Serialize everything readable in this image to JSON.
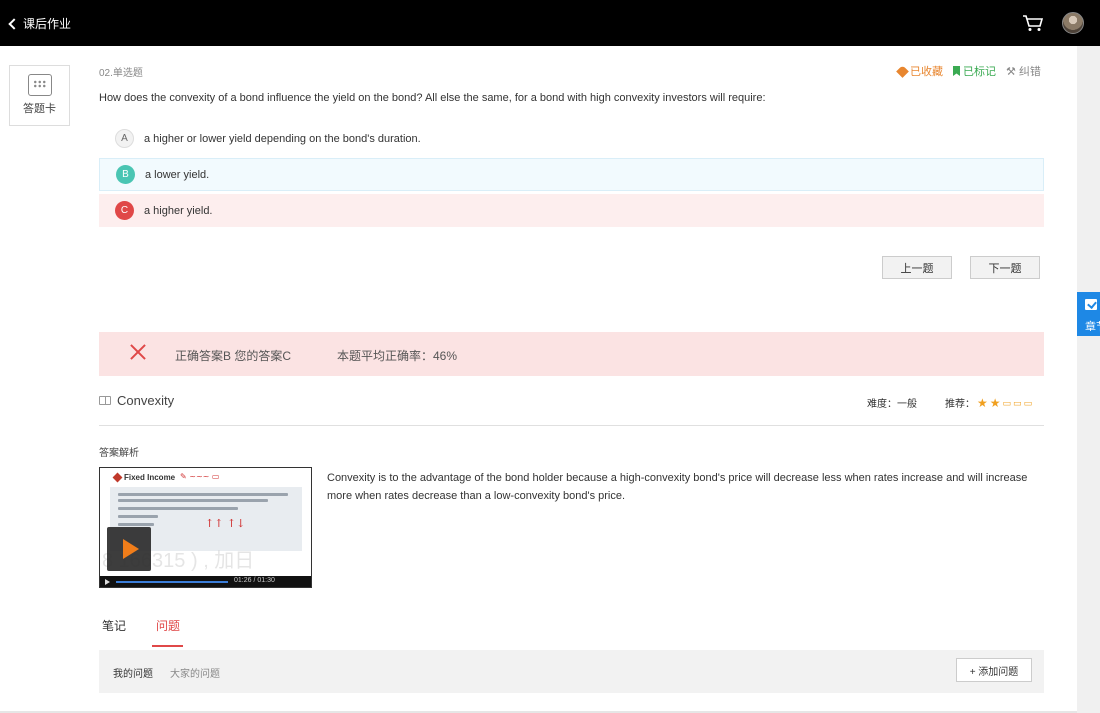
{
  "header": {
    "back_label": "课后作业"
  },
  "side_tab": {
    "label": "章节"
  },
  "answer_card": {
    "label": "答题卡"
  },
  "question": {
    "number": "02.单选题",
    "tools": {
      "favorite": "已收藏",
      "marked": "已标记",
      "report": "纠错"
    },
    "text": "How does the convexity of a bond influence the yield on the bond? All else the same, for a bond with high convexity investors will require:",
    "options": [
      {
        "letter": "A",
        "text": "a higher or lower yield depending on the bond's duration."
      },
      {
        "letter": "B",
        "text": "a lower yield."
      },
      {
        "letter": "C",
        "text": "a higher yield."
      }
    ]
  },
  "nav": {
    "prev": "上一题",
    "next": "下一题"
  },
  "result": {
    "answer_text": "正确答案B 您的答案C",
    "rate_text": "本题平均正确率：46%"
  },
  "topic": {
    "name": "Convexity",
    "difficulty": "难度：一般",
    "recommend_label": "推荐：",
    "rating": 2,
    "rating_max": 5
  },
  "explanation": {
    "label": "答案解析",
    "text": "Convexity is to the advantage of the bond holder because a high-convexity bond's price will decrease less when rates increase and will increase more when rates decrease than a low-convexity bond's price.",
    "video": {
      "slide_title": "Fixed Income",
      "watermark": "8 166315 ) , 加日",
      "time": "01:26 / 01:30"
    }
  },
  "tabs": {
    "notes": "笔记",
    "questions": "问题"
  },
  "qpanel": {
    "mine": "我的问题",
    "all": "大家的问题",
    "add": "+ 添加问题"
  },
  "colors": {
    "accent_red": "#e04848",
    "correct_teal": "#4ac5b3",
    "fav_orange": "#e8862f",
    "mark_green": "#3aaa52"
  }
}
